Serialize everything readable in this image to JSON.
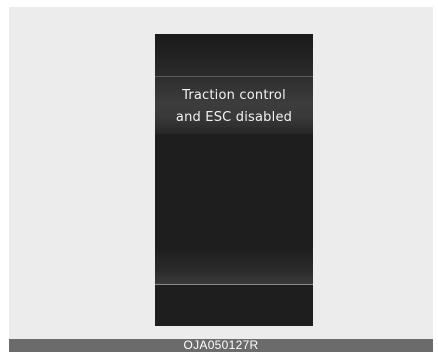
{
  "display": {
    "message_line_1": "Traction control",
    "message_line_2": "and ESC disabled"
  },
  "footer": {
    "code": "OJA050127R"
  },
  "colors": {
    "panel_background": "#ececec",
    "cluster_background": "#1e1e1e",
    "message_text": "#f2f2f2",
    "footer_bar": "#6b6b6b"
  }
}
